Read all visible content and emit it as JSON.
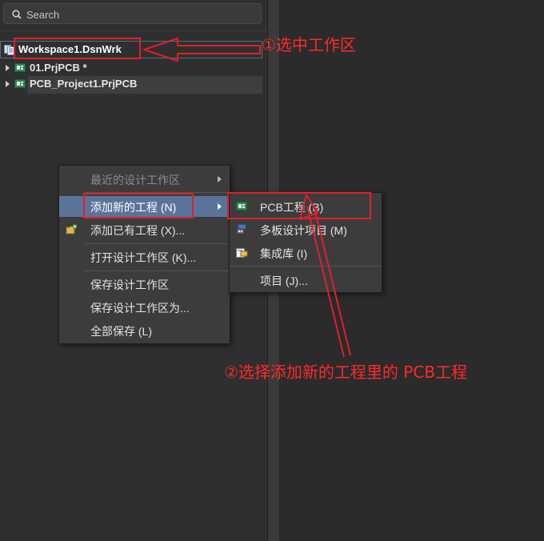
{
  "search": {
    "placeholder": "Search"
  },
  "tree": {
    "workspace": "Workspace1.DsnWrk",
    "projects": [
      {
        "label": "01.PrjPCB *"
      },
      {
        "label": "PCB_Project1.PrjPCB"
      }
    ]
  },
  "context_menu": {
    "items": [
      {
        "label": "最近的设计工作区"
      },
      {
        "label": "添加新的工程 (N)"
      },
      {
        "label": "添加已有工程 (X)..."
      },
      {
        "label": "打开设计工作区 (K)..."
      },
      {
        "label": "保存设计工作区"
      },
      {
        "label": "保存设计工作区为..."
      },
      {
        "label": "全部保存 (L)"
      }
    ]
  },
  "submenu": {
    "items": [
      {
        "label": "PCB工程 (B)"
      },
      {
        "label": "多板设计项目 (M)"
      },
      {
        "label": "集成库 (I)"
      },
      {
        "label": "项目 (J)..."
      }
    ]
  },
  "annotations": {
    "step1": "①选中工作区",
    "step2": "②选择添加新的工程里的 PCB工程",
    "color": "#e0202a"
  },
  "colors": {
    "menu_highlight": "#5a7499",
    "panel_bg": "#2f2f2f"
  }
}
